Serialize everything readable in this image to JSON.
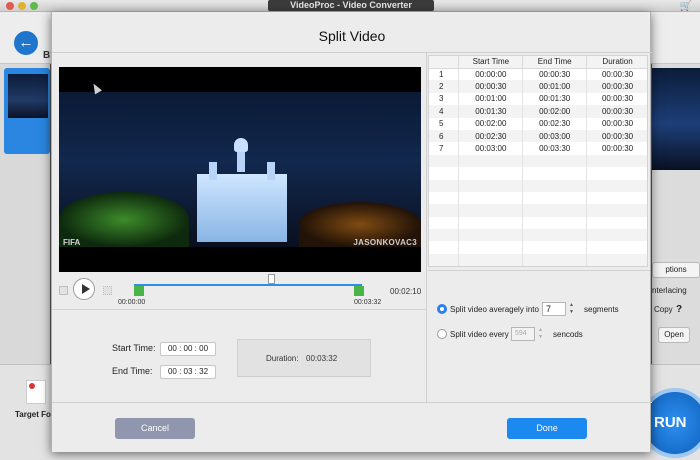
{
  "app": {
    "window_title": "VideoProc - Video Converter",
    "back_label": "B",
    "target_format_label": "Target For",
    "run_label": "RUN"
  },
  "bg_right_options": {
    "options_btn": "ptions",
    "interlacing": "nterlacing",
    "copy": "Copy",
    "help": "?",
    "open": "Open"
  },
  "dialog": {
    "title": "Split Video",
    "watermark_left": "FIFA",
    "watermark_right": "JASONKOVAC3",
    "timeline": {
      "current_time": "00:02:10",
      "start_marker": "00:00:00",
      "end_marker": "00:03:32"
    },
    "start_time_label": "Start Time:",
    "end_time_label": "End Time:",
    "start_time": "00 : 00 : 00",
    "end_time": "00 : 03 : 32",
    "duration_label": "Duration:",
    "duration": "00:03:32",
    "table": {
      "headers": [
        "",
        "Start Time",
        "End Time",
        "Duration"
      ],
      "rows": [
        [
          "1",
          "00:00:00",
          "00:00:30",
          "00:00:30"
        ],
        [
          "2",
          "00:00:30",
          "00:01:00",
          "00:00:30"
        ],
        [
          "3",
          "00:01:00",
          "00:01:30",
          "00:00:30"
        ],
        [
          "4",
          "00:01:30",
          "00:02:00",
          "00:00:30"
        ],
        [
          "5",
          "00:02:00",
          "00:02:30",
          "00:00:30"
        ],
        [
          "6",
          "00:02:30",
          "00:03:00",
          "00:00:30"
        ],
        [
          "7",
          "00:03:00",
          "00:03:30",
          "00:00:30"
        ]
      ]
    },
    "split_average": {
      "label": "Split video averagely into",
      "value": "7",
      "unit": "segments"
    },
    "split_every": {
      "label": "Split video every",
      "value": "594",
      "unit": "sencods"
    },
    "cancel_label": "Cancel",
    "done_label": "Done"
  }
}
